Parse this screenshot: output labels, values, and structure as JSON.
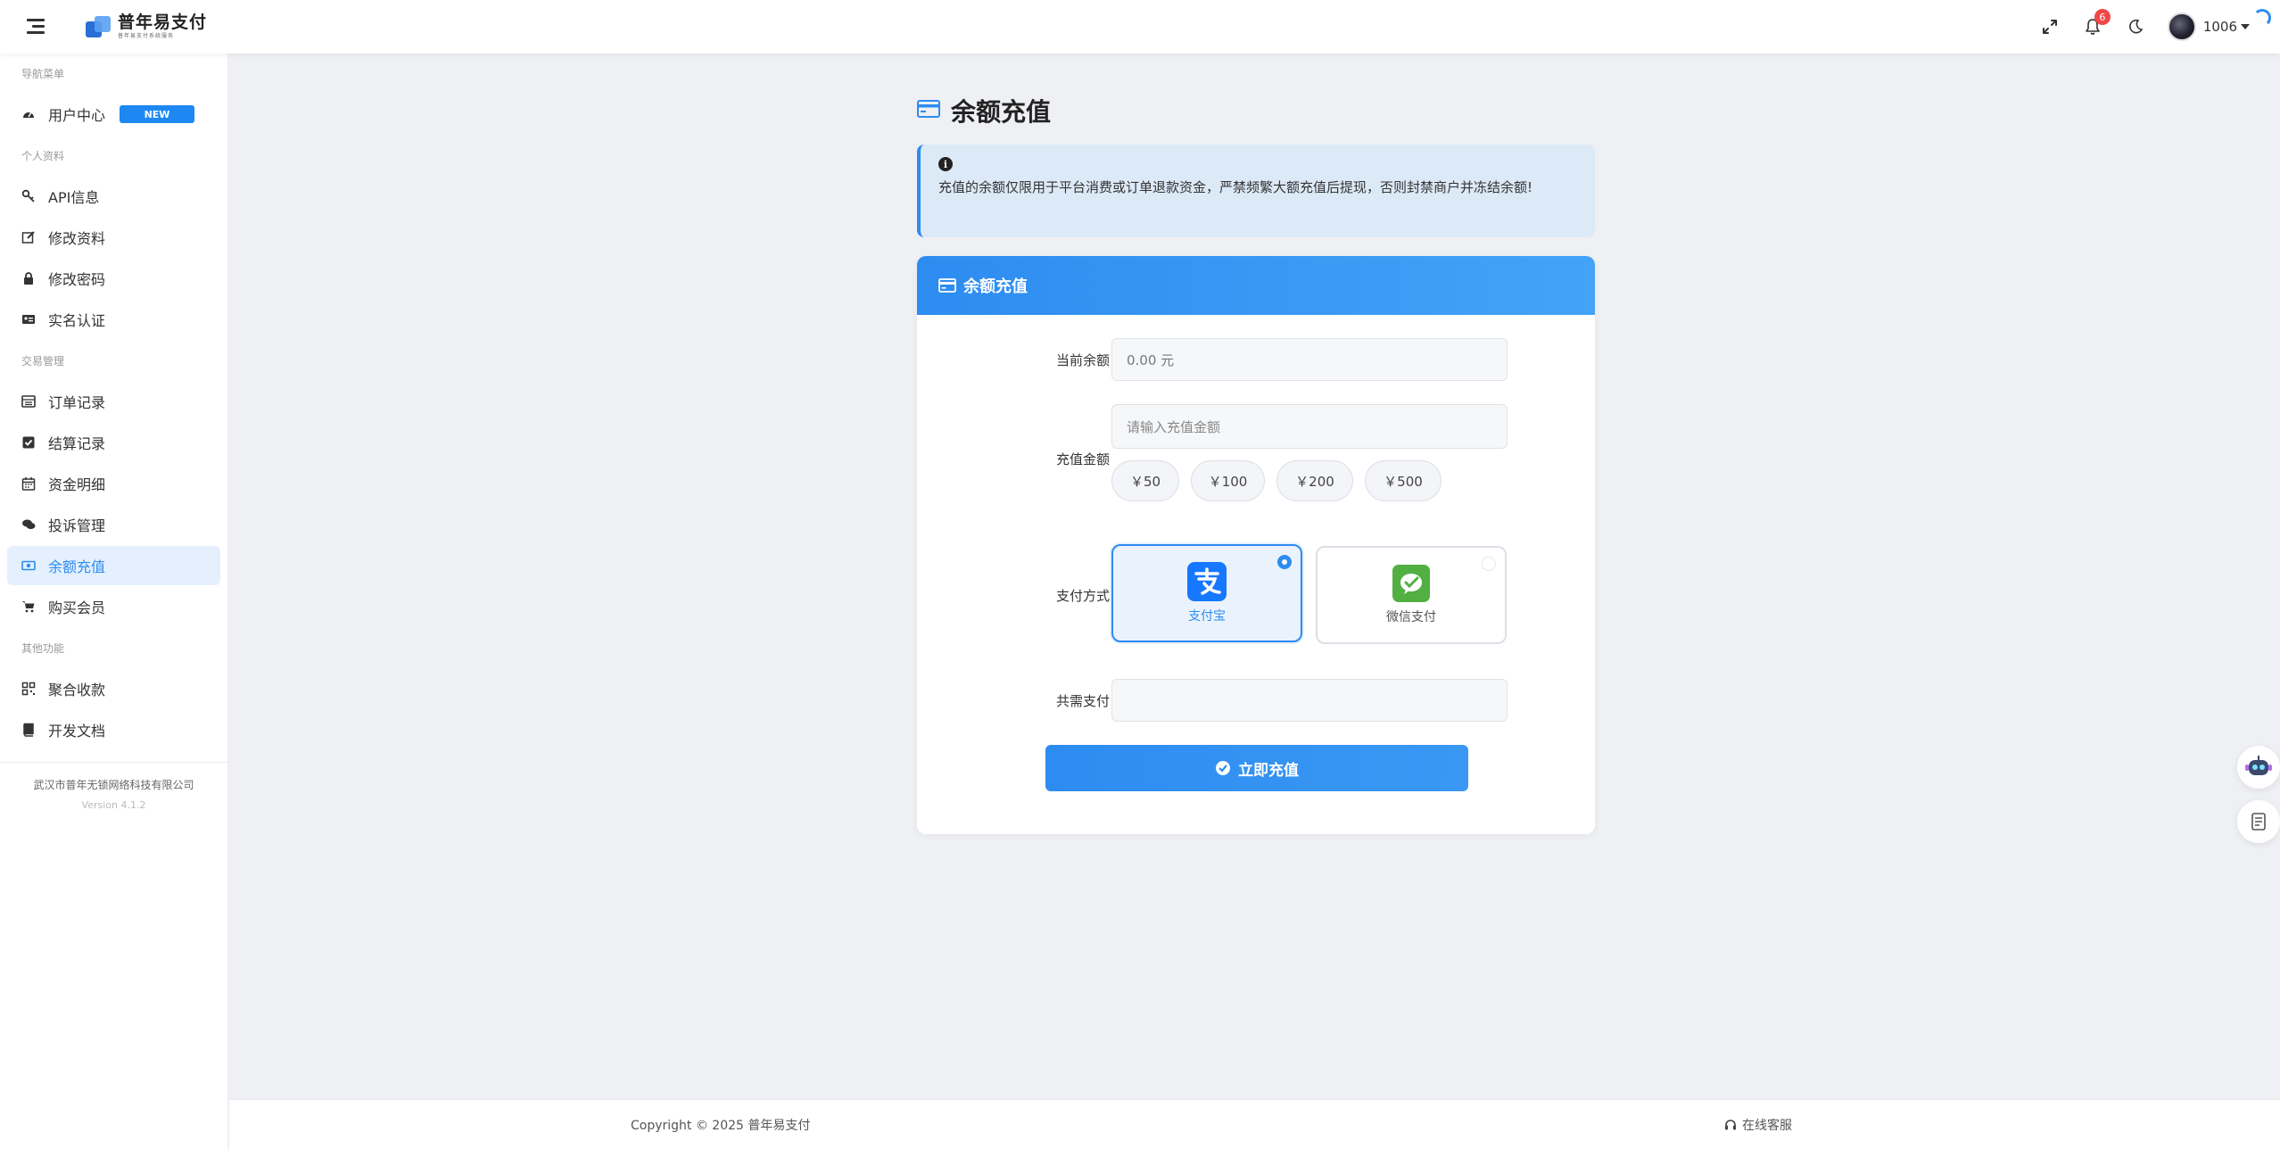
{
  "header": {
    "logo_title": "普年易支付",
    "logo_sub": "普年易支付系统服务",
    "notification_count": "6",
    "user_name": "1006"
  },
  "sidebar": {
    "section_nav": "导航菜单",
    "user_center": "用户中心",
    "new_badge": "NEW",
    "section_profile": "个人资料",
    "api_info": "API信息",
    "edit_profile": "修改资料",
    "change_password": "修改密码",
    "real_name": "实名认证",
    "section_trade": "交易管理",
    "orders": "订单记录",
    "settlements": "结算记录",
    "funds": "资金明细",
    "complaints": "投诉管理",
    "recharge": "余额充值",
    "buy_member": "购买会员",
    "section_other": "其他功能",
    "aggregate": "聚合收款",
    "dev_docs": "开发文档",
    "company": "武汉市普年无锁网络科技有限公司",
    "version": "Version 4.1.2"
  },
  "main": {
    "page_title": "余额充值",
    "notice": "充值的余额仅限用于平台消费或订单退款资金，严禁频繁大额充值后提现，否则封禁商户并冻结余额!",
    "card_title": "余额充值",
    "label_balance": "当前余额",
    "balance_value": "0.00 元",
    "label_amount": "充值金额",
    "amount_placeholder": "请输入充值金额",
    "quick_amounts": [
      "￥50",
      "￥100",
      "￥200",
      "￥500"
    ],
    "label_method": "支付方式",
    "alipay": "支付宝",
    "wechat": "微信支付",
    "label_total": "共需支付",
    "total_value": "",
    "submit": "立即充值"
  },
  "footer": {
    "copyright": "Copyright © 2025 普年易支付",
    "service": "在线客服"
  },
  "colors": {
    "accent": "#2d8cf0",
    "alipay": "#1677ff",
    "wechat": "#52b043",
    "badge": "#f04848"
  }
}
